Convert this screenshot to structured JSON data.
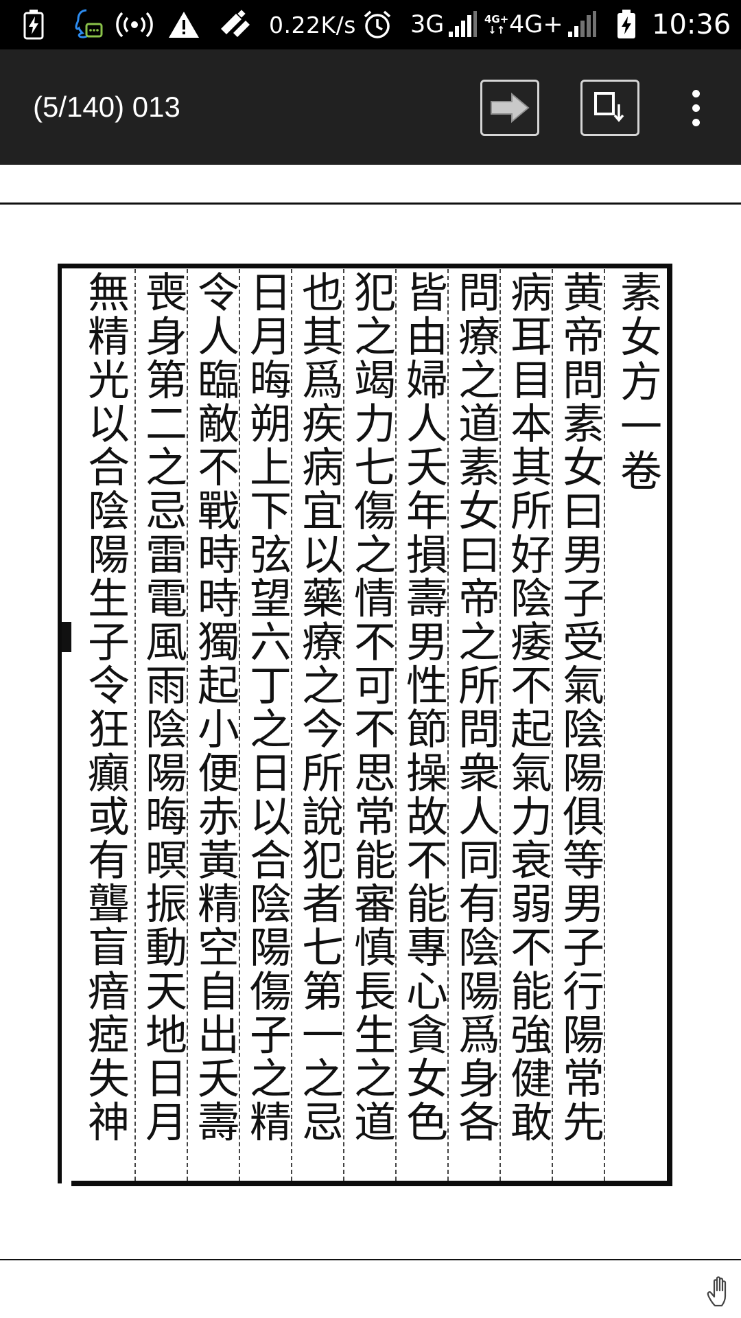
{
  "status_bar": {
    "network_speed": "0.22K/s",
    "network_3g": "3G",
    "network_4g_small_top": "4G+",
    "network_4g_small_arrows": "↓↑",
    "network_4g": "4G+",
    "time": "10:36",
    "icons": [
      "battery-charging-icon",
      "qq-message-icon",
      "hotspot-icon",
      "warning-icon",
      "tool-icon",
      "alarm-icon",
      "signal-icon",
      "signal-icon",
      "battery-icon"
    ]
  },
  "toolbar": {
    "title": "(5/140) 013",
    "next_icon": "arrow-right-icon",
    "extract_icon": "extract-page-icon",
    "menu_icon": "more-vertical-icon"
  },
  "document": {
    "columns": [
      "素女方一卷",
      "黄帝問素女曰男子受氣陰陽俱等男子行陽常先",
      "病耳目本其所好陰痿不起氣力衰弱不能強健敢",
      "問療之道素女曰帝之所問衆人同有陰陽爲身各",
      "皆由婦人夭年損壽男性節操故不能專心貪女色",
      "犯之竭力七傷之情不可不思常能審慎長生之道",
      "也其爲疾病宜以藥療之今所說犯者七第一之忌",
      "日月晦朔上下弦望六丁之日以合陰陽傷子之精",
      "令人臨敵不戰時時獨起小便赤黃精空自出夭壽",
      "喪身第二之忌雷電風雨陰陽晦暝振動天地日月",
      "無精光以合陰陽生子令狂癲或有聾盲瘖瘂失神"
    ]
  },
  "overlay": {
    "pan_icon": "hand-icon"
  }
}
